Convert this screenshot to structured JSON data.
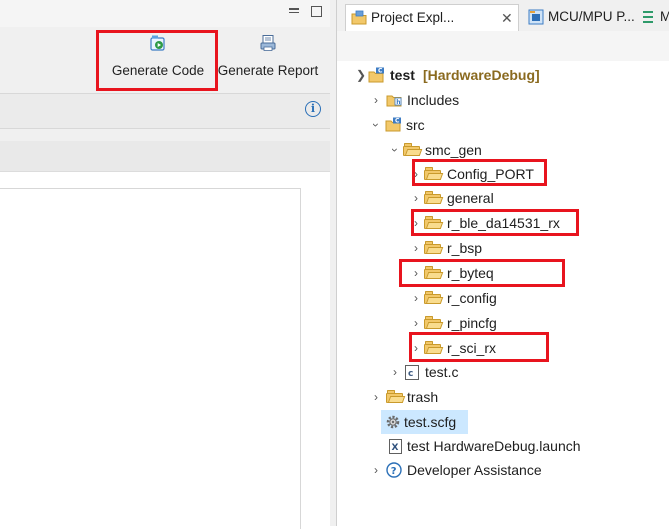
{
  "toolbar": {
    "generate_code": "Generate Code",
    "generate_report": "Generate Report"
  },
  "tabs": {
    "project_explorer": "Project Expl...",
    "mcu_mpu": "MCU/MPU P...",
    "third": "M"
  },
  "tree": {
    "project": {
      "name": "test",
      "config": "[HardwareDebug]"
    },
    "includes": "Includes",
    "src": "src",
    "smc_gen": "smc_gen",
    "items": [
      "Config_PORT",
      "general",
      "r_ble_da14531_rx",
      "r_bsp",
      "r_byteq",
      "r_config",
      "r_pincfg",
      "r_sci_rx"
    ],
    "test_c": "test.c",
    "trash": "trash",
    "test_scfg": "test.scfg",
    "launch": "test HardwareDebug.launch",
    "dev_assist": "Developer Assistance"
  },
  "colors": {
    "highlight": "#e8141e",
    "project_config": "#8a6a1f",
    "selection": "#cce8ff"
  }
}
